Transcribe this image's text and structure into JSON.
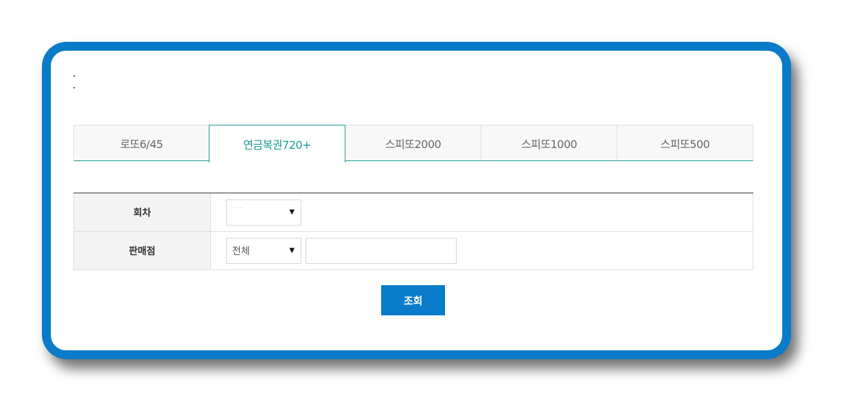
{
  "header": {
    "dots": [
      ".",
      "."
    ]
  },
  "tabs": [
    {
      "label": "로또6/45",
      "active": false
    },
    {
      "label": "연금복권720+",
      "active": true
    },
    {
      "label": "스피또2000",
      "active": false
    },
    {
      "label": "스피또1000",
      "active": false
    },
    {
      "label": "스피또500",
      "active": false
    }
  ],
  "form": {
    "round": {
      "label": "회차",
      "select_value": "- - -"
    },
    "store": {
      "label": "판매점",
      "select_value": "전체",
      "input_value": "",
      "input_placeholder": ""
    }
  },
  "search_button": {
    "label": "조회"
  },
  "colors": {
    "frame": "#0a7bc9",
    "tab_active": "#1a9a92",
    "button": "#0a7bc9"
  },
  "icons": {
    "select_caret": "triangle-down-icon"
  }
}
